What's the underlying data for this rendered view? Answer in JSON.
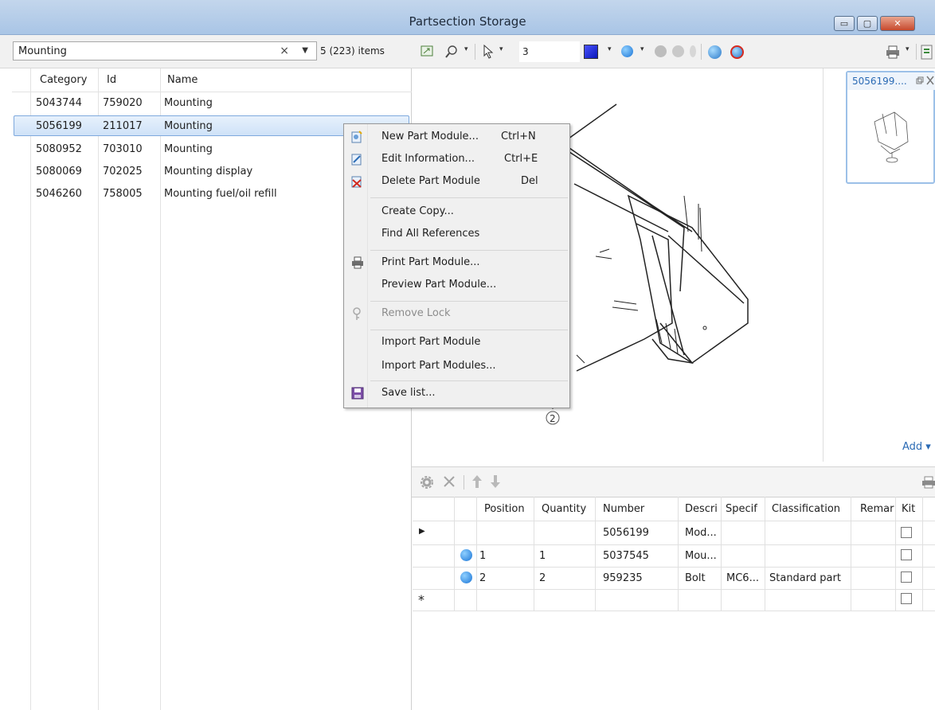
{
  "window": {
    "title": "Partsection Storage",
    "minimize": "▭",
    "maximize": "▢",
    "close": "✕"
  },
  "search": {
    "value": "Mounting",
    "clear": "×",
    "dropdown": "▼",
    "items_count": "5 (223) items"
  },
  "toolbar": {
    "zoom_value": "3",
    "caret": "▾"
  },
  "list": {
    "headers": [
      "Category",
      "Id",
      "Name"
    ],
    "rows": [
      {
        "category": "5043744",
        "id": "759020",
        "name": "Mounting"
      },
      {
        "category": "5056199",
        "id": "211017",
        "name": "Mounting"
      },
      {
        "category": "5080952",
        "id": "703010",
        "name": "Mounting"
      },
      {
        "category": "5080069",
        "id": "702025",
        "name": "Mounting display"
      },
      {
        "category": "5046260",
        "id": "758005",
        "name": "Mounting fuel/oil refill"
      }
    ]
  },
  "context_menu": {
    "new": {
      "label": "New Part Module...",
      "shortcut": "Ctrl+N"
    },
    "edit": {
      "label": "Edit Information...",
      "shortcut": "Ctrl+E"
    },
    "delete": {
      "label": "Delete Part Module",
      "shortcut": "Del"
    },
    "copy": "Create Copy...",
    "find_refs": "Find All References",
    "print": "Print Part Module...",
    "preview": "Preview Part Module...",
    "remove_lock": "Remove Lock",
    "import_one": "Import Part Module",
    "import_many": "Import Part Modules...",
    "save_list": "Save list..."
  },
  "preview": {
    "callout": "2"
  },
  "thumbnail": {
    "title": "5056199....",
    "add": "Add"
  },
  "grid": {
    "headers": [
      "Position",
      "Quantity",
      "Number",
      "Descri",
      "Specif",
      "Classification",
      "Remar",
      "Kit"
    ],
    "rows": [
      {
        "marker": "▶",
        "position": "",
        "quantity": "",
        "number": "5056199",
        "descr": "Mod...",
        "spec": "",
        "class": "",
        "remark": ""
      },
      {
        "marker": "",
        "position": "1",
        "quantity": "1",
        "number": "5037545",
        "descr": "Mou...",
        "spec": "",
        "class": "",
        "remark": ""
      },
      {
        "marker": "",
        "position": "2",
        "quantity": "2",
        "number": "959235",
        "descr": "Bolt",
        "spec": "MC6...",
        "class": "Standard part",
        "remark": ""
      },
      {
        "marker": "*",
        "position": "",
        "quantity": "",
        "number": "",
        "descr": "",
        "spec": "",
        "class": "",
        "remark": ""
      }
    ]
  }
}
